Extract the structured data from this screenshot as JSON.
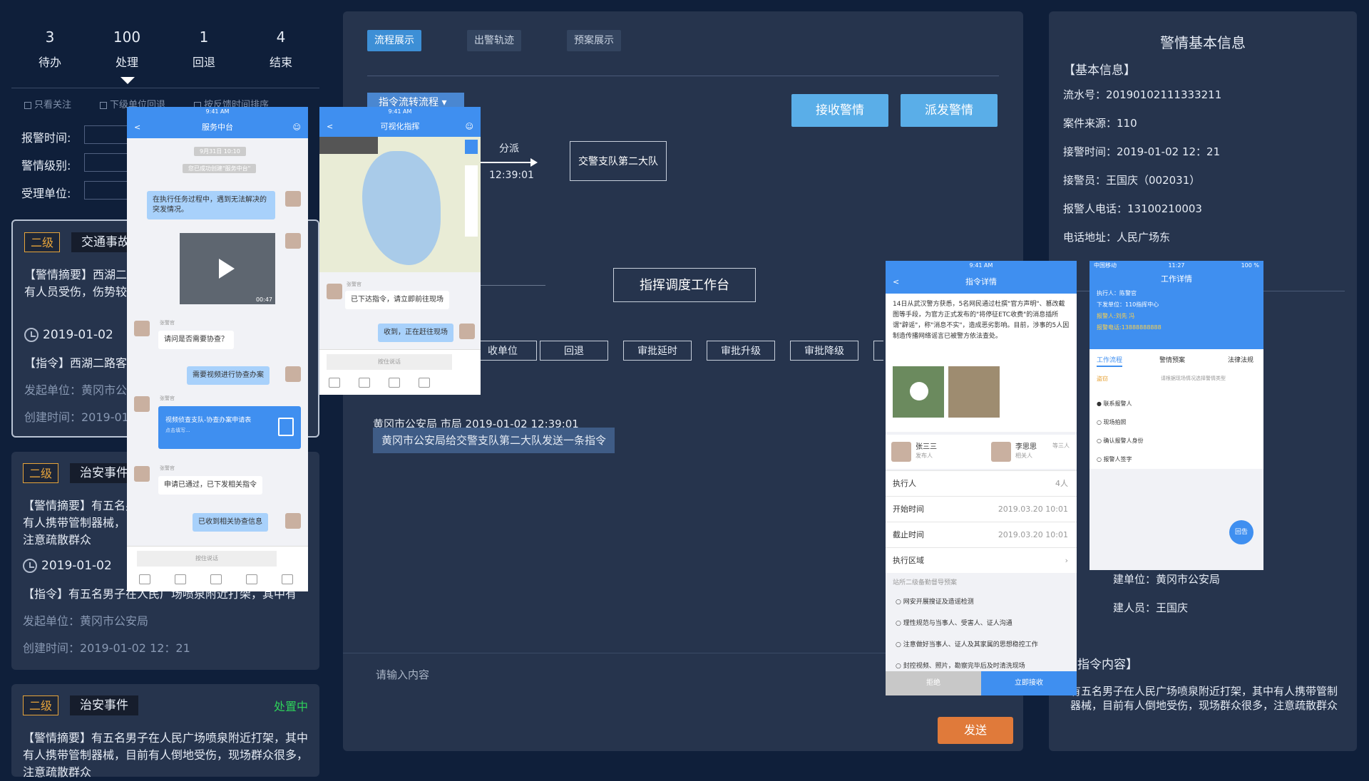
{
  "stats": [
    {
      "num": "3",
      "label": "待办"
    },
    {
      "num": "100",
      "label": "处理"
    },
    {
      "num": "1",
      "label": "回退"
    },
    {
      "num": "4",
      "label": "结束"
    }
  ],
  "filters": {
    "c1": "只看关注",
    "c2": "下级单位回退",
    "c3": "按反馈时间排序"
  },
  "form": {
    "f1": "报警时间:",
    "f2": "警情级别:",
    "f3": "受理单位:"
  },
  "cards": [
    {
      "level": "二级",
      "type": "交通事故",
      "status": "",
      "summary": "【警情摘要】西湖二路客运站附近发生交通事故，现场有人员受伤，伤势较",
      "time": "2019-01-02",
      "instruction": "【指令】西湖二路客",
      "unit": "发起单位：黄冈市公",
      "created": "创建时间：2019-01"
    },
    {
      "level": "二级",
      "type": "治安事件",
      "status": "",
      "summary": "【警情摘要】有五名男子在人民广场喷泉附近打架，其中有人携带管制器械，目前有人倒地受伤，现场群众很多，注意疏散群众",
      "time": "2019-01-02",
      "instruction": "【指令】有五名男子在人民广场喷泉附近打架，其中有",
      "unit": "发起单位：黄冈市公安局",
      "created": "创建时间：2019-01-02 12：21"
    },
    {
      "level": "二级",
      "type": "治安事件",
      "status": "处置中",
      "summary": "【警情摘要】有五名男子在人民广场喷泉附近打架，其中有人携带管制器械，目前有人倒地受伤，现场群众很多，注意疏散群众"
    }
  ],
  "mid": {
    "tabs": [
      "流程展示",
      "出警轨迹",
      "预案展示"
    ],
    "flow_btn": "指令流转流程",
    "receive": "接收警情",
    "dispatch": "派发警情",
    "edge_label": "分派",
    "edge_time": "12:39:01",
    "node_target": "交警支队第二大队",
    "workbench": "指挥调度工作台",
    "ops": [
      "收单位",
      "回退",
      "审批延时",
      "审批升级",
      "审批降级"
    ],
    "log_line": "黄冈市公安局    市局    2019-01-02 12:39:01",
    "log_msg": "黄冈市公安局给交警支队第二大队发送一条指令",
    "input_placeholder": "请输入内容",
    "send": "发送"
  },
  "right": {
    "title": "警情基本信息",
    "section1": "【基本信息】",
    "serial": "流水号：20190102111333211",
    "source": "案件来源：110",
    "recv_time": "接警时间：2019-01-02 12：21",
    "officer": "接警员：王国庆（002031）",
    "phone": "报警人电话：13100210003",
    "address": "电话地址：人民广场东",
    "unit": "建单位：黄冈市公安局",
    "person": "建人员：王国庆",
    "section2": "指令内容】",
    "content": "有五名男子在人民广场喷泉附近打架，其中有人携带管制器械，目前有人倒地受伤，现场群众很多，注意疏散群众"
  },
  "phone1": {
    "status": "9:41 AM",
    "title": "服务中台",
    "date": "9月31日 10:10",
    "sys": "您已成功创建\"服务中台\"",
    "m1": "在执行任务过程中，遇到无法解决的突发情况。",
    "m2": "请问是否需要协查？",
    "m3": "需要视频进行协查办案",
    "m4": "视频侦查支队-协查办案申请表",
    "m4s": "点击填写...",
    "m5": "申请已通过，已下发相关指令",
    "m6": "已收到相关协查信息",
    "input": "按住说话",
    "name": "张警官",
    "video": "00:47"
  },
  "phone2": {
    "status": "9:41 AM",
    "title": "可视化指挥",
    "m1": "已下达指令，请立即前往现场",
    "m2": "收到，正在赶往现场",
    "input": "按住说话",
    "name": "张警官"
  },
  "phone3": {
    "status": "9:41 AM",
    "title": "指令详情",
    "text": "14日从武汉警方获悉，5名网民通过杜撰\"官方声明\"、篡改截图等手段，为官方正式发布的\"将停征ETC收费\"的消息插所谓\"辟谣\"，称\"消息不实\"，造成恶劣影响。目前，涉事的5人因制造传播网络谣言已被警方依法查处。",
    "p1": "张三三",
    "p1r": "发布人",
    "p2": "李思思",
    "p2r": "相关人",
    "p2n": "等三人",
    "r1": "执行人",
    "r1v": "4人",
    "r2": "开始时间",
    "r2v": "2019.03.20 10:01",
    "r3": "截止时间",
    "r3v": "2019.03.20 10:01",
    "r4": "执行区域",
    "sec": "站所二级备勤督导预案",
    "o1": "网安开展搜证及造谣检测",
    "o2": "理性规范与当事人、受害人、证人沟通",
    "o3": "注意做好当事人、证人及其家属的思想稳控工作",
    "o4": "封控视频、照片，勘察完毕后及时清洗现场",
    "reject": "拒绝",
    "accept": "立即接收"
  },
  "phone4": {
    "status": "11:27",
    "carrier": "中国移动",
    "battery": "100 %",
    "title": "工作详情",
    "l1": "执行人：陈警官",
    "l2": "下发单位：110指挥中心",
    "l3": "报警人:刘先 冯",
    "l4": "报警电话:13888888888",
    "t1": "工作流程",
    "t2": "警情预案",
    "t3": "法律法规",
    "head": "盗窃",
    "hint": "请根据现场情况选择警情类型",
    "s1": "联系报警人",
    "s2": "现场拍照",
    "s3": "确认报警人身份",
    "s4": "报警人签字",
    "fab": "回告"
  }
}
